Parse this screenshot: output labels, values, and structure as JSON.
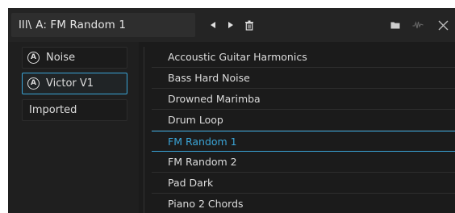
{
  "header": {
    "library_glyph": "III\\",
    "preset_name": "A: FM Random 1",
    "icons": {
      "prev": "triangle-left-icon",
      "next": "triangle-right-icon",
      "delete": "trash-icon",
      "folder": "folder-icon",
      "waveform": "waveform-icon",
      "close": "close-icon"
    }
  },
  "banks": [
    {
      "label": "Noise",
      "badge": "A",
      "selected": false
    },
    {
      "label": "Victor V1",
      "badge": "A",
      "selected": true
    },
    {
      "label": "Imported",
      "badge": "",
      "selected": false
    }
  ],
  "presets": [
    {
      "label": "Accoustic Guitar Harmonics",
      "selected": false
    },
    {
      "label": "Bass Hard Noise",
      "selected": false
    },
    {
      "label": "Drowned Marimba",
      "selected": false
    },
    {
      "label": "Drum Loop",
      "selected": false
    },
    {
      "label": "FM Random 1",
      "selected": true
    },
    {
      "label": "FM Random 2",
      "selected": false
    },
    {
      "label": "Pad Dark",
      "selected": false
    },
    {
      "label": "Piano 2 Chords",
      "selected": false
    }
  ],
  "colors": {
    "accent": "#3aa4d6",
    "background": "#1b1b1b",
    "text": "#dcdcdc"
  }
}
